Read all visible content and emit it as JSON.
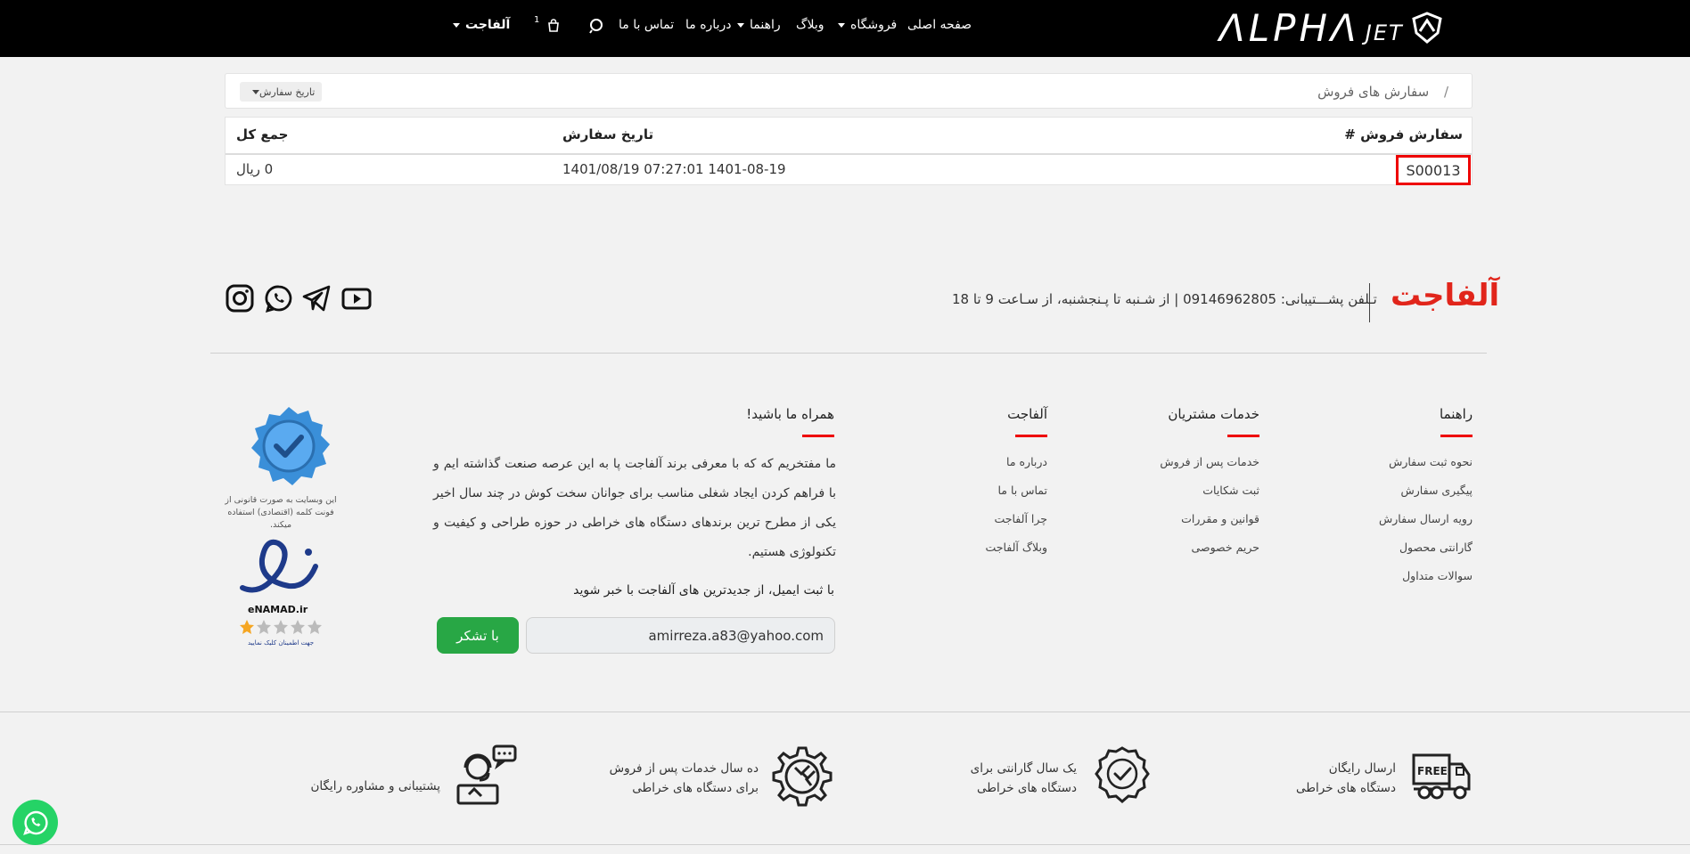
{
  "header": {
    "logo_main": "ΛLPHΛ",
    "logo_sub": "JET",
    "nav": {
      "home": "صفحه اصلی",
      "shop": "فروشگاه",
      "blog": "وبلاگ",
      "guide": "راهنما",
      "about": "درباره ما",
      "contact": "تماس با ما",
      "cart_count": "1",
      "account": "آلفاجت"
    }
  },
  "breadcrumb": {
    "separator": "/",
    "current": "سفارش های فروش",
    "filter_label": "تاریخ سفارش"
  },
  "orders_table": {
    "headers": {
      "order": "سفارش فروش #",
      "date": "تاریخ سفارش",
      "total": "جمع کل"
    },
    "rows": [
      {
        "order_id": "S00013",
        "date": "1401/08/19  07:27:01 1401-08-19",
        "total": "0 ریال"
      }
    ]
  },
  "footer": {
    "brand": "آلفاجت",
    "support": "تـلفن پشـــتیبانی: 09146962805  |  از شـنبه تا پـنجشنبه، از سـاعت 9 تا 18",
    "columns": {
      "guide": {
        "title": "راهنما",
        "links": [
          "نحوه ثبت سفارش",
          "پیگیری سفارش",
          "رویه ارسال سفارش",
          "گارانتی محصول",
          "سوالات متداول"
        ]
      },
      "services": {
        "title": "خدمات مشتریان",
        "links": [
          "خدمات پس از فروش",
          "ثبت شکایات",
          "قوانین و مقررات",
          "حریم خصوصی"
        ]
      },
      "alphajet": {
        "title": "آلفاجت",
        "links": [
          "درباره ما",
          "تماس با ما",
          "چرا آلفاجت",
          "وبلاگ آلفاجت"
        ]
      },
      "about": {
        "title": "همراه ما باشید!",
        "text": "ما مفتخریم که که با معرفی برند آلفاجت پا به این عرصه صنعت گذاشته ایم و با فراهم کردن ایجاد شغلی مناسب برای جوانان سخت کوش در چند سال اخیر یکی از مطرح ترین برندهای دستگاه های خراطی در حوزه طراحی و کیفیت و تکنولوژی هستیم."
      }
    },
    "newsletter": {
      "label": "با ثبت ایمیل، از جدیدترین های آلفاجت با خبر شوید",
      "email_value": "amirreza.a83@yahoo.com",
      "button": "با تشکر"
    },
    "badge_text": "این وبسایت به صورت قانونی از فونت کلمه (اقتصادی) استفاده میکند.",
    "enamad": {
      "label": "eNAMAD.ir",
      "sub": "جهت اطمینان کلیک نمایید"
    },
    "features": {
      "shipping": [
        "ارسال رایگان",
        "دستگاه های خراطی"
      ],
      "warranty": [
        "یک سال گارانتی برای",
        "دستگاه های خراطی"
      ],
      "service": [
        "ده سال  خدمات پس از فروش",
        "برای دستگاه های خراطی"
      ],
      "support": [
        "پشتیبانی و مشاوره رایگان"
      ],
      "free_label": "FREE"
    }
  },
  "colors": {
    "header_bg": "#000000",
    "accent_red": "#e1251b",
    "highlight": "#ee0000",
    "button_green": "#28a745",
    "whatsapp": "#25d366"
  }
}
